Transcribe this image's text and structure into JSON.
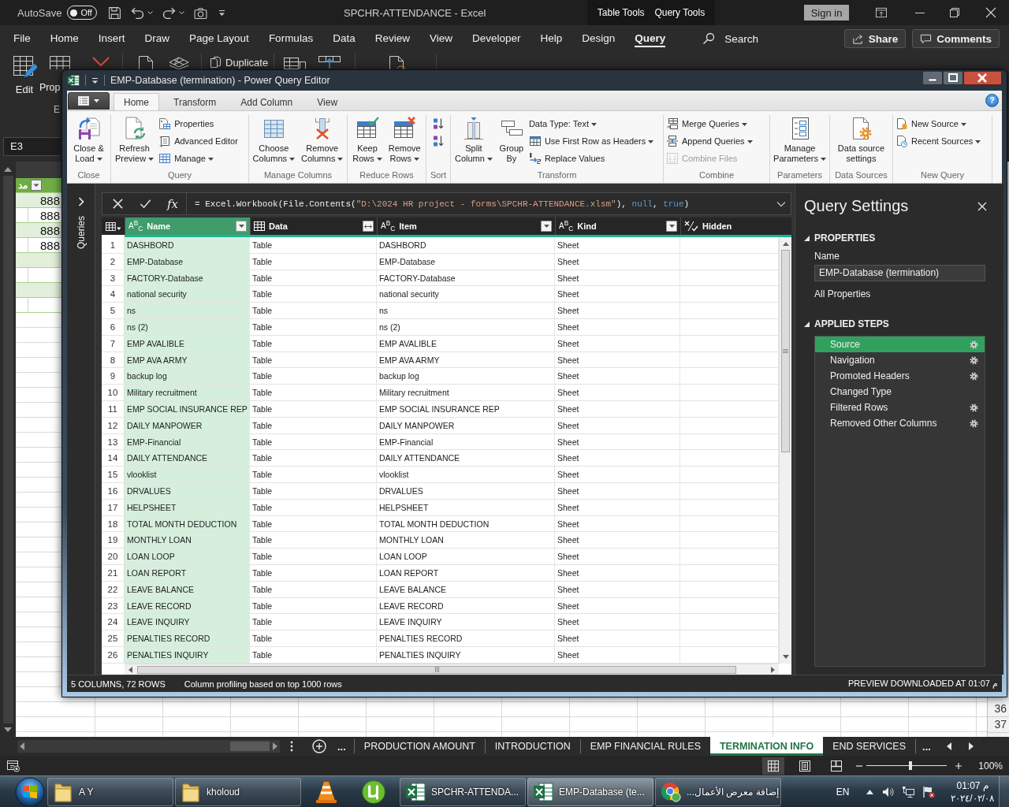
{
  "excel": {
    "title_bar": {
      "autosave": {
        "label": "AutoSave",
        "toggle_text": "Off",
        "on": false
      },
      "title": "SPCHR-ATTENDANCE - Excel",
      "context_tabs": [
        "Table Tools",
        "Query Tools"
      ],
      "sign_in": "Sign in"
    },
    "menu": {
      "tabs": [
        {
          "label": "File",
          "selected": false
        },
        {
          "label": "Home",
          "selected": false
        },
        {
          "label": "Insert",
          "selected": false
        },
        {
          "label": "Draw",
          "selected": false
        },
        {
          "label": "Page Layout",
          "selected": false
        },
        {
          "label": "Formulas",
          "selected": false
        },
        {
          "label": "Data",
          "selected": false
        },
        {
          "label": "Review",
          "selected": false
        },
        {
          "label": "View",
          "selected": false
        },
        {
          "label": "Developer",
          "selected": false
        },
        {
          "label": "Help",
          "selected": false
        },
        {
          "label": "Design",
          "selected": false
        },
        {
          "label": "Query",
          "selected": true
        }
      ],
      "search": "Search",
      "share": "Share",
      "comments": "Comments"
    },
    "ribbon": {
      "large_buttons": [
        "Edit",
        "Prop"
      ],
      "small_buttons": [
        "Duplicate"
      ],
      "group_label": "E"
    },
    "name_box": "E3",
    "sheet": {
      "header_cells": [
        "مد"
      ],
      "cells": [
        "888",
        "888",
        "888",
        "888"
      ],
      "row_headers": [
        "36",
        "37"
      ]
    },
    "sheet_tabs": {
      "more_left": "...",
      "tabs": [
        {
          "label": "PRODUCTION AMOUNT",
          "selected": false
        },
        {
          "label": "INTRODUCTION",
          "selected": false
        },
        {
          "label": "EMP FINANCIAL RULES",
          "selected": false
        },
        {
          "label": "TERMINATION INFO",
          "selected": true
        },
        {
          "label": "END SERVICES",
          "selected": false
        }
      ],
      "more_right": "..."
    },
    "status_bar": {
      "views": [
        {
          "selected": true
        },
        {
          "selected": false
        },
        {
          "selected": false
        }
      ],
      "zoom": {
        "level": 0.55,
        "reading": "100%"
      }
    }
  },
  "power_query": {
    "title": "EMP-Database (termination) - Power Query Editor",
    "ribbon": {
      "tabs": [
        {
          "label": "Home",
          "selected": true
        },
        {
          "label": "Transform",
          "selected": false
        },
        {
          "label": "Add Column",
          "selected": false
        },
        {
          "label": "View",
          "selected": false
        }
      ],
      "help": "?",
      "groups": [
        {
          "label": "Close",
          "items": [
            {
              "kind": "large",
              "label": "Close &\nLoad",
              "dropdown": true
            }
          ]
        },
        {
          "label": "Query",
          "items": [
            {
              "kind": "large",
              "label": "Refresh\nPreview",
              "dropdown": true
            },
            {
              "kind": "small",
              "label": "Properties",
              "dropdown": false
            },
            {
              "kind": "small",
              "label": "Advanced Editor",
              "dropdown": false
            },
            {
              "kind": "small",
              "label": "Manage",
              "dropdown": true
            }
          ]
        },
        {
          "label": "Manage Columns",
          "items": [
            {
              "kind": "large",
              "label": "Choose\nColumns",
              "dropdown": true
            },
            {
              "kind": "large",
              "label": "Remove\nColumns",
              "dropdown": true
            }
          ]
        },
        {
          "label": "Reduce Rows",
          "items": [
            {
              "kind": "large",
              "label": "Keep\nRows",
              "dropdown": true
            },
            {
              "kind": "large",
              "label": "Remove\nRows",
              "dropdown": true
            }
          ]
        },
        {
          "label": "Sort",
          "items": [
            {
              "kind": "icon",
              "dropdown": false
            },
            {
              "kind": "icon",
              "dropdown": false
            }
          ]
        },
        {
          "label": "Transform",
          "items": [
            {
              "kind": "large",
              "label": "Split\nColumn",
              "dropdown": true
            },
            {
              "kind": "large",
              "label": "Group\nBy",
              "dropdown": false
            },
            {
              "kind": "small",
              "label": "Data Type: Text",
              "dropdown": true
            },
            {
              "kind": "small",
              "label": "Use First Row as Headers",
              "dropdown": true
            },
            {
              "kind": "small",
              "label": "Replace Values",
              "dropdown": false
            }
          ]
        },
        {
          "label": "Combine",
          "items": [
            {
              "kind": "small",
              "label": "Merge Queries",
              "dropdown": true,
              "disabled": false
            },
            {
              "kind": "small",
              "label": "Append Queries",
              "dropdown": true,
              "disabled": false
            },
            {
              "kind": "small",
              "label": "Combine Files",
              "dropdown": false,
              "disabled": true
            }
          ]
        },
        {
          "label": "Parameters",
          "items": [
            {
              "kind": "large",
              "label": "Manage\nParameters",
              "dropdown": true
            }
          ]
        },
        {
          "label": "Data Sources",
          "items": [
            {
              "kind": "large",
              "label": "Data source\nsettings",
              "dropdown": false
            }
          ]
        },
        {
          "label": "New Query",
          "items": [
            {
              "kind": "small",
              "label": "New Source",
              "dropdown": true
            },
            {
              "kind": "small",
              "label": "Recent Sources",
              "dropdown": true
            }
          ]
        }
      ]
    },
    "queries_pane": {
      "label": "Queries"
    },
    "formula_bar": {
      "fx": "fx",
      "tokens": [
        {
          "kind": "code",
          "text": "= Excel.Workbook(File.Contents("
        },
        {
          "kind": "string",
          "text": "\"D:\\2024 HR project - forms\\SPCHR-ATTENDANCE.xlsm\""
        },
        {
          "kind": "code",
          "text": "), "
        },
        {
          "kind": "keyword",
          "text": "null"
        },
        {
          "kind": "code",
          "text": ", "
        },
        {
          "kind": "keyword",
          "text": "true"
        },
        {
          "kind": "code",
          "text": ")"
        }
      ]
    },
    "table": {
      "columns": [
        {
          "name": "Name",
          "kind": "text",
          "type_label": "A$^{B}$$_{C}$",
          "selected": true
        },
        {
          "name": "Data",
          "kind": "table",
          "selected": false
        },
        {
          "name": "Item",
          "kind": "text",
          "type_label": "A$^{B}$$_{C}$",
          "selected": false
        },
        {
          "name": "Kind",
          "kind": "text",
          "type_label": "A$^{B}$$_{C}$",
          "selected": false
        },
        {
          "name": "Hidden",
          "kind": "logical",
          "selected": false
        }
      ],
      "rows": [
        {
          "number": "1",
          "cells": [
            "DASHBORD",
            "Table",
            "DASHBORD",
            "Sheet"
          ]
        },
        {
          "number": "2",
          "cells": [
            "EMP-Database",
            "Table",
            "EMP-Database",
            "Sheet"
          ]
        },
        {
          "number": "3",
          "cells": [
            "FACTORY-Database",
            "Table",
            "FACTORY-Database",
            "Sheet"
          ]
        },
        {
          "number": "4",
          "cells": [
            "national security",
            "Table",
            "national security",
            "Sheet"
          ]
        },
        {
          "number": "5",
          "cells": [
            "ns",
            "Table",
            "ns",
            "Sheet"
          ]
        },
        {
          "number": "6",
          "cells": [
            "ns (2)",
            "Table",
            "ns (2)",
            "Sheet"
          ]
        },
        {
          "number": "7",
          "cells": [
            "EMP AVALIBLE",
            "Table",
            "EMP AVALIBLE",
            "Sheet"
          ]
        },
        {
          "number": "8",
          "cells": [
            "EMP AVA ARMY",
            "Table",
            "EMP AVA ARMY",
            "Sheet"
          ]
        },
        {
          "number": "9",
          "cells": [
            "backup log",
            "Table",
            "backup log",
            "Sheet"
          ]
        },
        {
          "number": "10",
          "cells": [
            "Military recruitment",
            "Table",
            "Military recruitment",
            "Sheet"
          ]
        },
        {
          "number": "11",
          "cells": [
            "EMP SOCIAL INSURANCE REP",
            "Table",
            "EMP SOCIAL INSURANCE REP",
            "Sheet"
          ]
        },
        {
          "number": "12",
          "cells": [
            "DAILY MANPOWER",
            "Table",
            "DAILY MANPOWER",
            "Sheet"
          ]
        },
        {
          "number": "13",
          "cells": [
            "EMP-Financial",
            "Table",
            "EMP-Financial",
            "Sheet"
          ]
        },
        {
          "number": "14",
          "cells": [
            "DAILY ATTENDANCE",
            "Table",
            "DAILY ATTENDANCE",
            "Sheet"
          ]
        },
        {
          "number": "15",
          "cells": [
            "vlooklist",
            "Table",
            "vlooklist",
            "Sheet"
          ]
        },
        {
          "number": "16",
          "cells": [
            "DRVALUES",
            "Table",
            "DRVALUES",
            "Sheet"
          ]
        },
        {
          "number": "17",
          "cells": [
            "HELPSHEET",
            "Table",
            "HELPSHEET",
            "Sheet"
          ]
        },
        {
          "number": "18",
          "cells": [
            "TOTAL MONTH DEDUCTION",
            "Table",
            "TOTAL MONTH DEDUCTION",
            "Sheet"
          ]
        },
        {
          "number": "19",
          "cells": [
            "MONTHLY LOAN",
            "Table",
            "MONTHLY LOAN",
            "Sheet"
          ]
        },
        {
          "number": "20",
          "cells": [
            "LOAN LOOP",
            "Table",
            "LOAN LOOP",
            "Sheet"
          ]
        },
        {
          "number": "21",
          "cells": [
            "LOAN REPORT",
            "Table",
            "LOAN REPORT",
            "Sheet"
          ]
        },
        {
          "number": "22",
          "cells": [
            "LEAVE BALANCE",
            "Table",
            "LEAVE BALANCE",
            "Sheet"
          ]
        },
        {
          "number": "23",
          "cells": [
            "LEAVE RECORD",
            "Table",
            "LEAVE RECORD",
            "Sheet"
          ]
        },
        {
          "number": "24",
          "cells": [
            "LEAVE INQUIRY",
            "Table",
            "LEAVE INQUIRY",
            "Sheet"
          ]
        },
        {
          "number": "25",
          "cells": [
            "PENALTIES RECORD",
            "Table",
            "PENALTIES RECORD",
            "Sheet"
          ]
        },
        {
          "number": "26",
          "cells": [
            "PENALTIES INQUIRY",
            "Table",
            "PENALTIES INQUIRY",
            "Sheet"
          ]
        }
      ]
    },
    "query_settings": {
      "title": "Query Settings",
      "properties": {
        "title": "PROPERTIES",
        "expanded": true,
        "name_label": "Name",
        "name_value": "EMP-Database (termination)",
        "all_properties": "All Properties"
      },
      "applied_steps": {
        "title": "APPLIED STEPS",
        "expanded": true,
        "steps": [
          {
            "label": "Source",
            "selected": true,
            "has_settings": true
          },
          {
            "label": "Navigation",
            "selected": false,
            "has_settings": true
          },
          {
            "label": "Promoted Headers",
            "selected": false,
            "has_settings": true
          },
          {
            "label": "Changed Type",
            "selected": false,
            "has_settings": false
          },
          {
            "label": "Filtered Rows",
            "selected": false,
            "has_settings": true
          },
          {
            "label": "Removed Other Columns",
            "selected": false,
            "has_settings": true
          }
        ]
      }
    },
    "status_bar": {
      "left": [
        "5 COLUMNS, 72 ROWS",
        "Column profiling based on top 1000 rows"
      ],
      "right": "PREVIEW DOWNLOADED AT 01:07 م"
    }
  },
  "taskbar": {
    "buttons": [
      {
        "label": "A Y",
        "selected": false
      },
      {
        "label": "kholoud",
        "selected": false
      },
      {
        "label": "SPCHR-ATTENDA...",
        "selected": false
      },
      {
        "label": "EMP-Database (te...",
        "selected": true
      },
      {
        "label": "إضافة معرض الأعمال...",
        "selected": false
      }
    ],
    "language": "EN",
    "clock": {
      "time": "01:07 م",
      "date": "٢٠٢٤/٠٢/٠٨"
    }
  }
}
